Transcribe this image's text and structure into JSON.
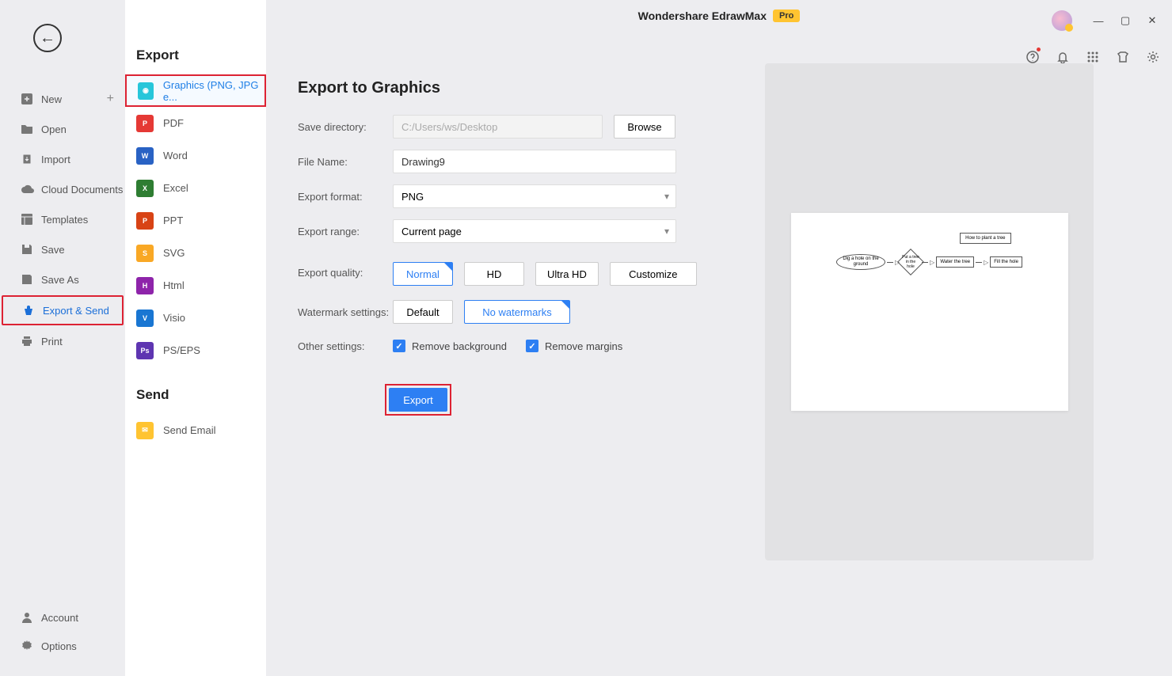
{
  "header": {
    "app_title": "Wondershare EdrawMax",
    "pro_badge": "Pro"
  },
  "left_nav": {
    "items": [
      {
        "label": "New",
        "has_plus": true
      },
      {
        "label": "Open"
      },
      {
        "label": "Import"
      },
      {
        "label": "Cloud Documents"
      },
      {
        "label": "Templates"
      },
      {
        "label": "Save"
      },
      {
        "label": "Save As"
      },
      {
        "label": "Export & Send",
        "highlighted": true
      },
      {
        "label": "Print"
      }
    ],
    "bottom": [
      {
        "label": "Account"
      },
      {
        "label": "Options"
      }
    ]
  },
  "export_sidebar": {
    "export_heading": "Export",
    "export_items": [
      {
        "label": "Graphics (PNG, JPG e...",
        "highlighted": true
      },
      {
        "label": "PDF"
      },
      {
        "label": "Word"
      },
      {
        "label": "Excel"
      },
      {
        "label": "PPT"
      },
      {
        "label": "SVG"
      },
      {
        "label": "Html"
      },
      {
        "label": "Visio"
      },
      {
        "label": "PS/EPS"
      }
    ],
    "send_heading": "Send",
    "send_items": [
      {
        "label": "Send Email"
      }
    ]
  },
  "form": {
    "title": "Export to Graphics",
    "save_dir_label": "Save directory:",
    "save_dir_value": "C:/Users/ws/Desktop",
    "browse": "Browse",
    "filename_label": "File Name:",
    "filename_value": "Drawing9",
    "format_label": "Export format:",
    "format_value": "PNG",
    "range_label": "Export range:",
    "range_value": "Current page",
    "quality_label": "Export quality:",
    "quality_options": {
      "normal": "Normal",
      "hd": "HD",
      "uhd": "Ultra HD",
      "customize": "Customize"
    },
    "watermark_label": "Watermark settings:",
    "watermark_default": "Default",
    "watermark_none": "No watermarks",
    "other_label": "Other settings:",
    "remove_bg": "Remove background",
    "remove_margins": "Remove margins",
    "export_btn": "Export"
  },
  "preview": {
    "title_box": "How to plant a tree",
    "n1": "Dig a hole on the ground",
    "n2": "Put a tree in the hole",
    "n3": "Water the tree",
    "n4": "Fill the hole"
  }
}
